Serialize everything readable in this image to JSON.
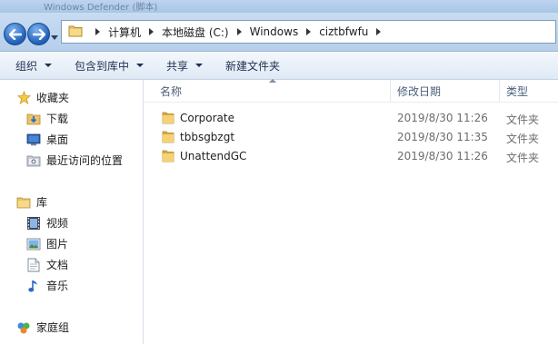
{
  "window": {
    "title": "Windows Defender (脚本)"
  },
  "address": {
    "crumbs": [
      "计算机",
      "本地磁盘 (C:)",
      "Windows",
      "ciztbfwfu"
    ]
  },
  "toolbar": {
    "organize": "组织",
    "include_in_library": "包含到库中",
    "share": "共享",
    "new_folder": "新建文件夹"
  },
  "nav": {
    "favorites": "收藏夹",
    "downloads": "下载",
    "desktop": "桌面",
    "recent": "最近访问的位置",
    "libraries": "库",
    "videos": "视频",
    "pictures": "图片",
    "documents": "文档",
    "music": "音乐",
    "homegroup": "家庭组"
  },
  "columns": {
    "name": "名称",
    "modified": "修改日期",
    "type": "类型"
  },
  "files": [
    {
      "name": "Corporate",
      "modified": "2019/8/30 11:26",
      "type": "文件夹"
    },
    {
      "name": "tbbsgbzgt",
      "modified": "2019/8/30 11:35",
      "type": "文件夹"
    },
    {
      "name": "UnattendGC",
      "modified": "2019/8/30 11:26",
      "type": "文件夹"
    }
  ],
  "icons": {
    "back": "back-arrow-icon",
    "forward": "forward-arrow-icon",
    "folder": "folder-icon",
    "star": "star-icon",
    "download": "download-folder-icon",
    "desktop": "desktop-icon",
    "recent": "recent-places-icon",
    "library": "library-icon",
    "video": "video-icon",
    "picture": "picture-icon",
    "document": "document-icon",
    "music": "music-icon",
    "homegroup": "homegroup-icon"
  }
}
